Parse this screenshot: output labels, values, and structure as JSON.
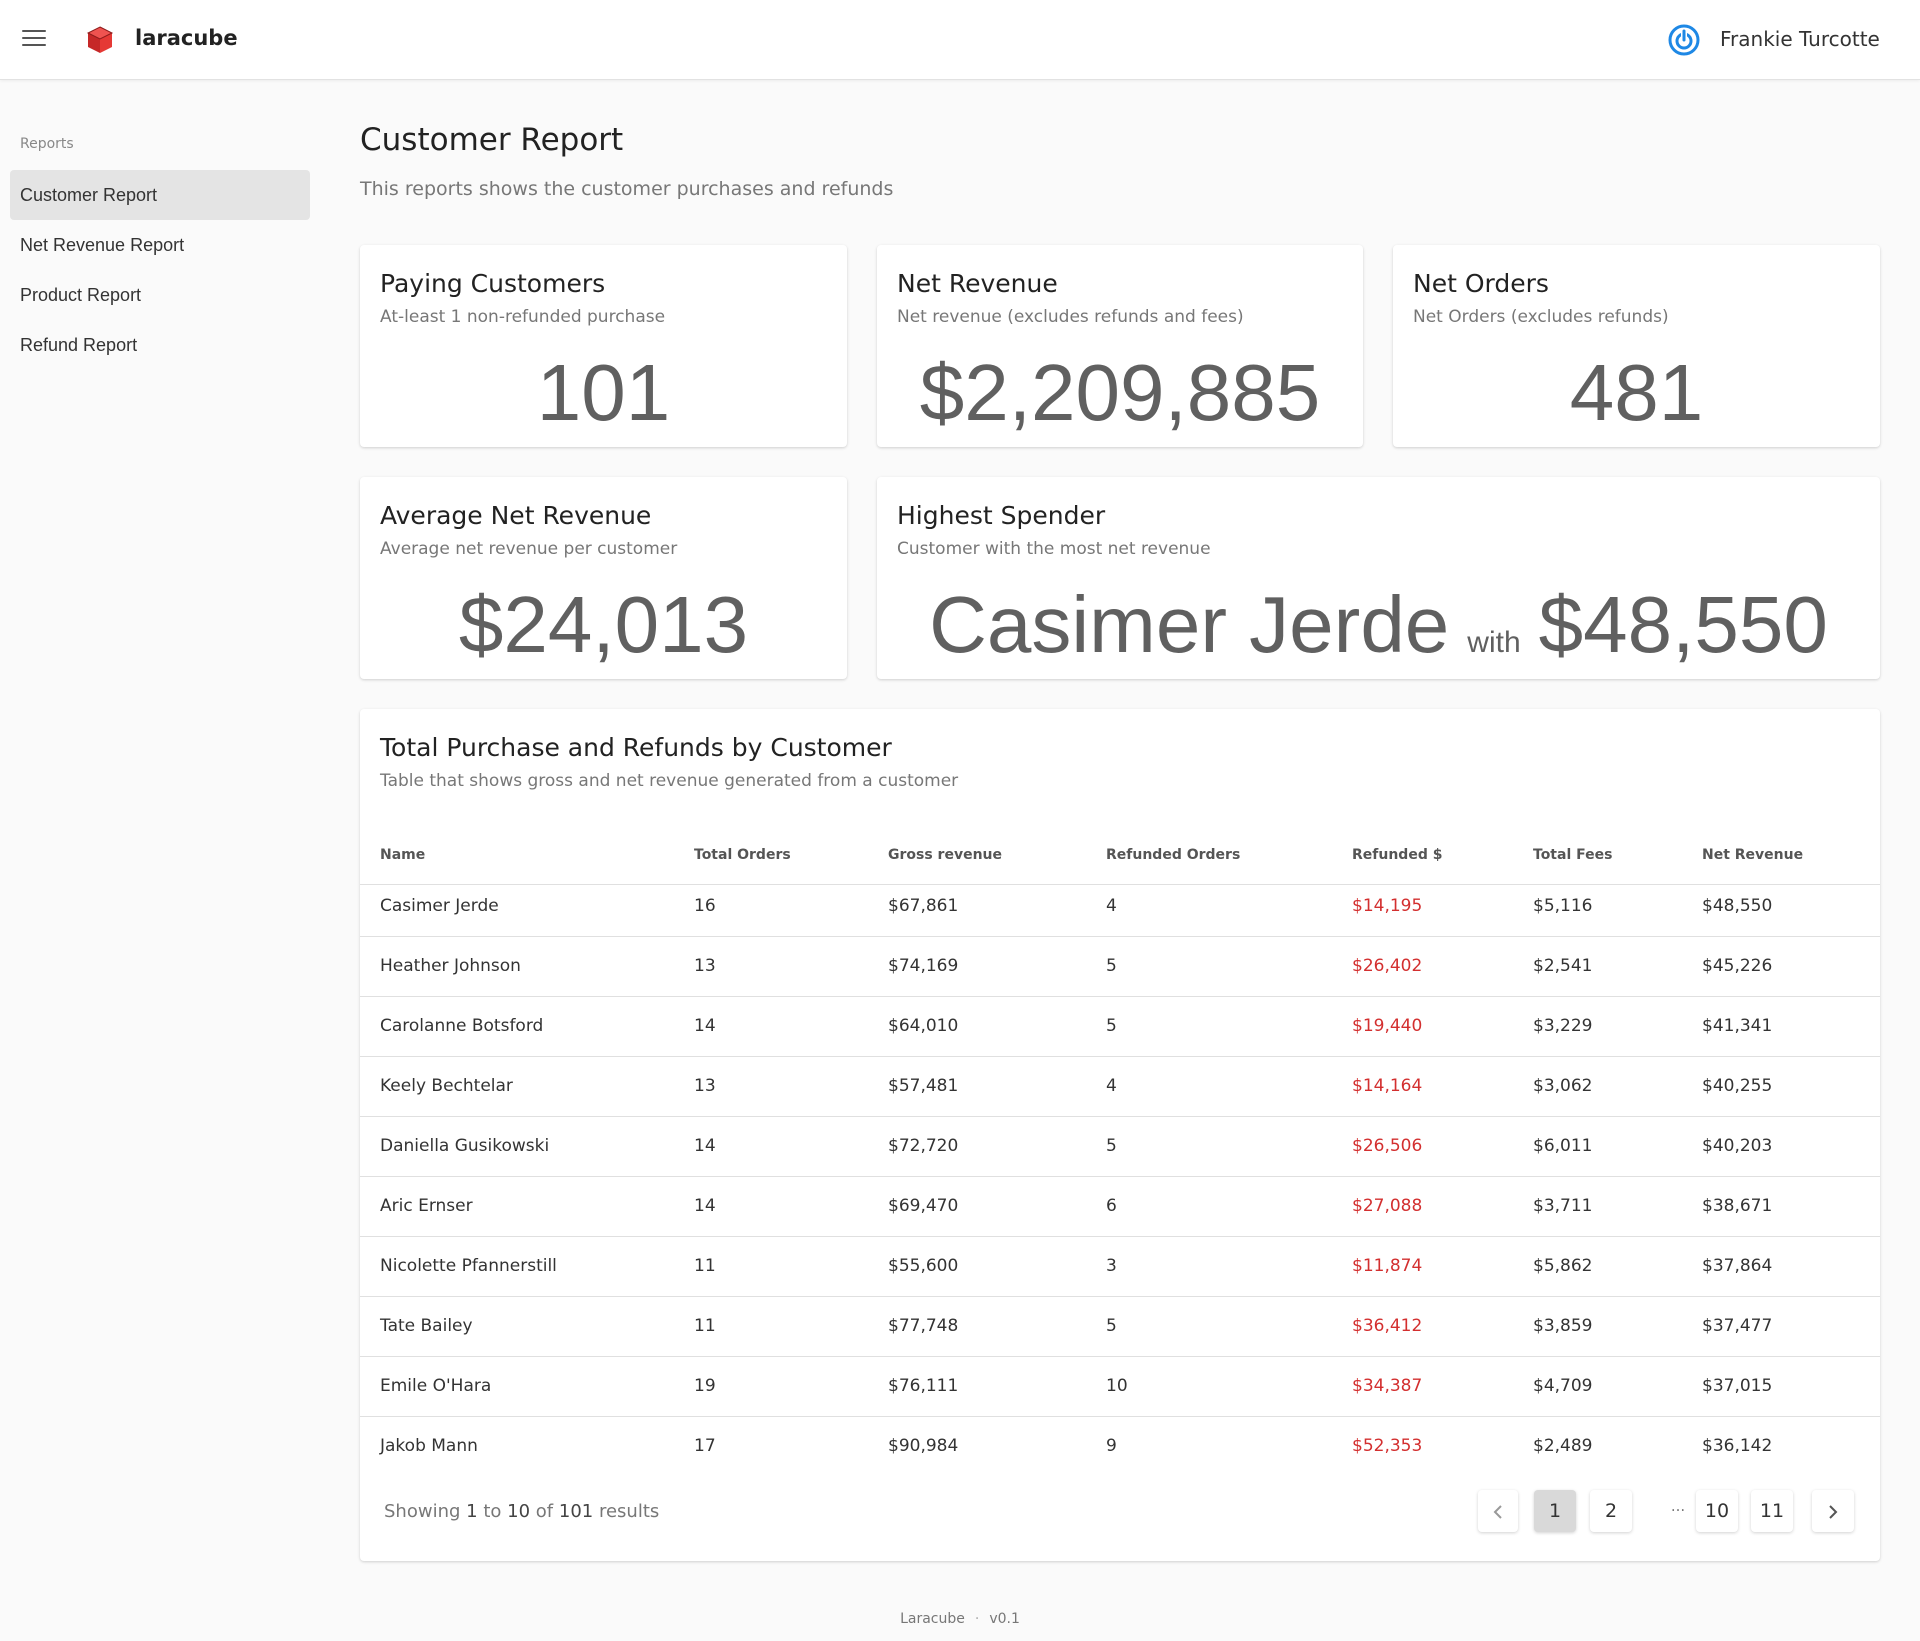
{
  "app": {
    "brand": "laracube",
    "user": "Frankie Turcotte"
  },
  "sidebar": {
    "section": "Reports",
    "items": [
      {
        "label": "Customer Report",
        "active": true
      },
      {
        "label": "Net Revenue Report"
      },
      {
        "label": "Product Report"
      },
      {
        "label": "Refund Report"
      }
    ]
  },
  "page": {
    "title": "Customer Report",
    "subtitle": "This reports shows the customer purchases and refunds"
  },
  "cards": {
    "paying": {
      "title": "Paying Customers",
      "sub": "At-least 1 non-refunded purchase",
      "value": "101"
    },
    "net_revenue": {
      "title": "Net Revenue",
      "sub": "Net revenue (excludes refunds and fees)",
      "value": "$2,209,885"
    },
    "net_orders": {
      "title": "Net Orders",
      "sub": "Net Orders (excludes refunds)",
      "value": "481"
    },
    "avg": {
      "title": "Average Net Revenue",
      "sub": "Average net revenue per customer",
      "value": "$24,013"
    },
    "highest": {
      "title": "Highest Spender",
      "sub": "Customer with the most net revenue",
      "name": "Casimer Jerde",
      "with": "with",
      "amount": "$48,550"
    }
  },
  "table": {
    "title": "Total Purchase and Refunds by Customer",
    "sub": "Table that shows gross and net revenue generated from a customer",
    "headers": [
      "Name",
      "Total Orders",
      "Gross revenue",
      "Refunded Orders",
      "Refunded $",
      "Total Fees",
      "Net Revenue"
    ],
    "rows": [
      [
        "Casimer Jerde",
        "16",
        "$67,861",
        "4",
        "$14,195",
        "$5,116",
        "$48,550"
      ],
      [
        "Heather Johnson",
        "13",
        "$74,169",
        "5",
        "$26,402",
        "$2,541",
        "$45,226"
      ],
      [
        "Carolanne Botsford",
        "14",
        "$64,010",
        "5",
        "$19,440",
        "$3,229",
        "$41,341"
      ],
      [
        "Keely Bechtelar",
        "13",
        "$57,481",
        "4",
        "$14,164",
        "$3,062",
        "$40,255"
      ],
      [
        "Daniella Gusikowski",
        "14",
        "$72,720",
        "5",
        "$26,506",
        "$6,011",
        "$40,203"
      ],
      [
        "Aric Ernser",
        "14",
        "$69,470",
        "6",
        "$27,088",
        "$3,711",
        "$38,671"
      ],
      [
        "Nicolette Pfannerstill",
        "11",
        "$55,600",
        "3",
        "$11,874",
        "$5,862",
        "$37,864"
      ],
      [
        "Tate Bailey",
        "11",
        "$77,748",
        "5",
        "$36,412",
        "$3,859",
        "$37,477"
      ],
      [
        "Emile O'Hara",
        "19",
        "$76,111",
        "10",
        "$34,387",
        "$4,709",
        "$37,015"
      ],
      [
        "Jakob Mann",
        "17",
        "$90,984",
        "9",
        "$52,353",
        "$2,489",
        "$36,142"
      ]
    ],
    "showing": {
      "pre": "Showing",
      "from": "1",
      "to_word": "to",
      "to": "10",
      "of_word": "of",
      "total": "101",
      "post": "results"
    },
    "pagination": {
      "pages": [
        "1",
        "2",
        "10",
        "11"
      ],
      "ellipsis": "...",
      "current": "1"
    }
  },
  "footer": {
    "name": "Laracube",
    "sep": "·",
    "version": "v0.1"
  },
  "colors": {
    "refund_red": "#d32f2f",
    "brand_red": "#e53935",
    "power_blue": "#1e88e5"
  }
}
